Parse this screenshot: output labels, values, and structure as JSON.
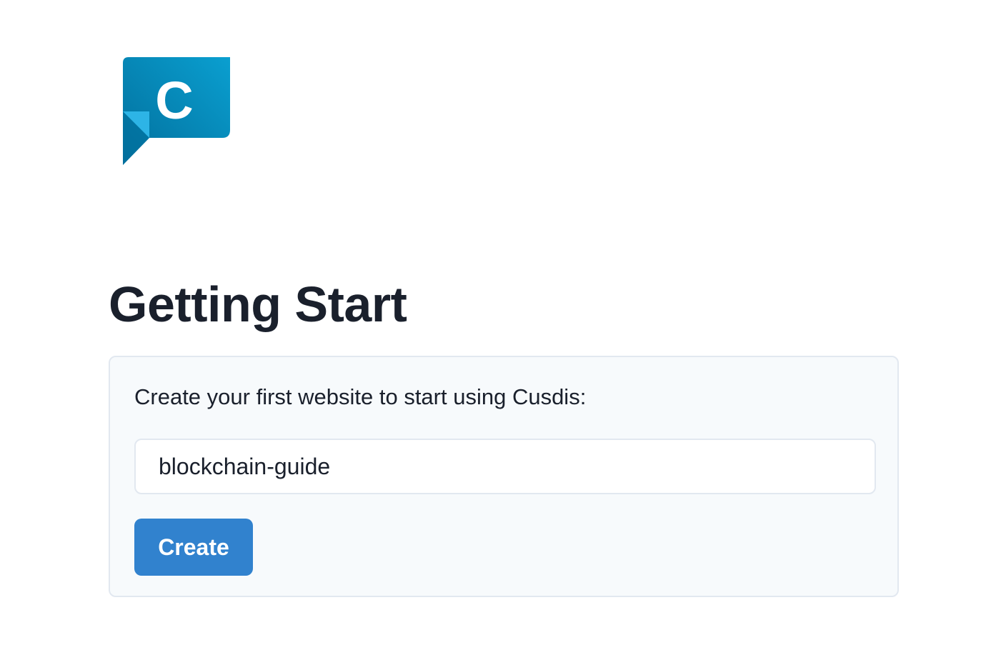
{
  "brand": {
    "logo_letter": "C",
    "logo_icon": "cusdis-speech-bubble-logo",
    "colors": {
      "logo_dark": "#0279a8",
      "logo_light": "#0699c9",
      "logo_fold": "#2db4e6"
    }
  },
  "page": {
    "title": "Getting Start"
  },
  "card": {
    "prompt": "Create your first website to start using Cusdis:",
    "website_name_value": "blockchain-guide",
    "create_label": "Create"
  },
  "colors": {
    "primary_button": "#3182ce",
    "card_background": "#f7fafc",
    "border": "#e2e8f0",
    "text": "#1a202c"
  }
}
